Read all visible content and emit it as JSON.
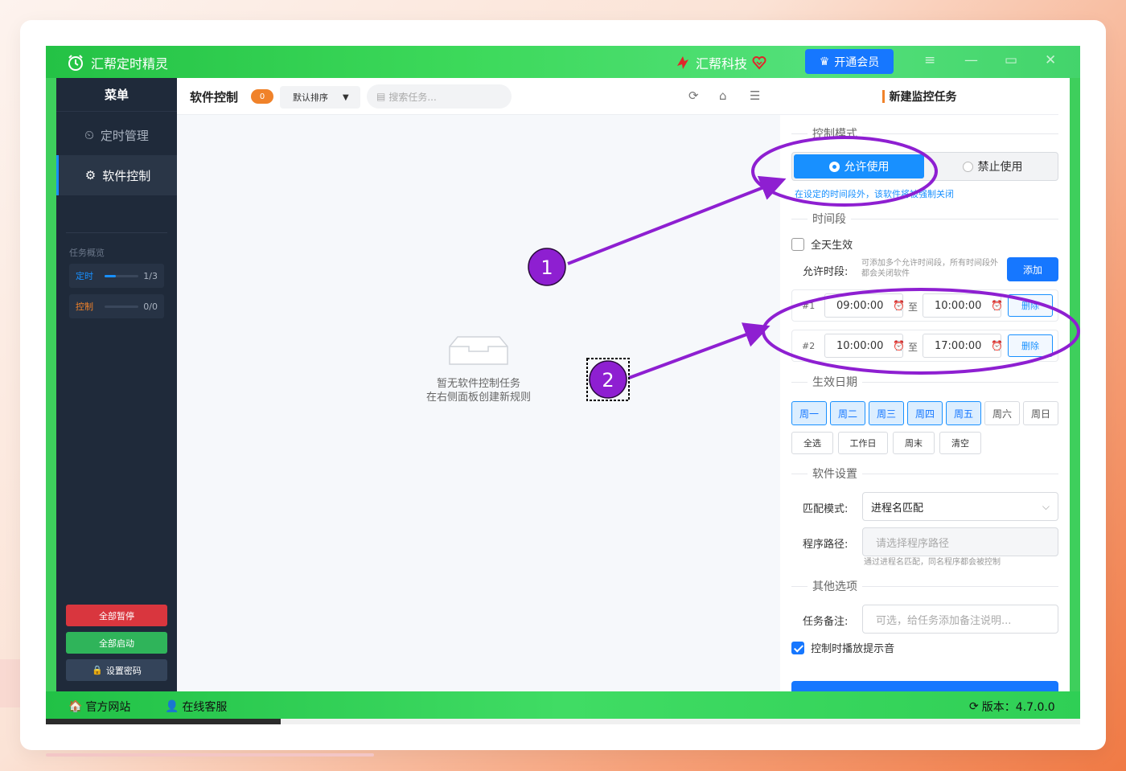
{
  "titlebar": {
    "app_title": "汇帮定时精灵",
    "brand": "汇帮科技",
    "vip_label": "开通会员"
  },
  "sidebar": {
    "header": "菜单",
    "items": [
      {
        "label": "定时管理"
      },
      {
        "label": "软件控制"
      }
    ],
    "overview_title": "任务概览",
    "overview": [
      {
        "label": "定时",
        "value": "1/3",
        "fraction": 0.33,
        "color": "#1890ff"
      },
      {
        "label": "控制",
        "value": "0/0",
        "fraction": 0,
        "color": "#f0822a"
      }
    ],
    "btn_pause_all": "全部暂停",
    "btn_start_all": "全部启动",
    "btn_set_password": "设置密码"
  },
  "content": {
    "title": "软件控制",
    "count": "0",
    "sort_label": "默认排序",
    "search_placeholder": "搜索任务...",
    "empty_line1": "暂无软件控制任务",
    "empty_line2": "在右侧面板创建新规则"
  },
  "panel": {
    "title": "新建监控任务",
    "section_mode": "控制模式",
    "mode_allow": "允许使用",
    "mode_forbid": "禁止使用",
    "mode_hint": "在设定的时间段外，该软件将被强制关闭",
    "section_time": "时间段",
    "all_day_label": "全天生效",
    "allowed_label": "允许时段:",
    "allowed_hint": "可添加多个允许时间段，所有时间段外都会关闭软件",
    "add_btn": "添加",
    "to_label": "至",
    "delete_label": "删除",
    "periods": [
      {
        "num": "#1",
        "start": "09:00:00",
        "end": "10:00:00"
      },
      {
        "num": "#2",
        "start": "10:00:00",
        "end": "17:00:00"
      }
    ],
    "section_days": "生效日期",
    "days": [
      {
        "label": "周一",
        "on": true
      },
      {
        "label": "周二",
        "on": true
      },
      {
        "label": "周三",
        "on": true
      },
      {
        "label": "周四",
        "on": true
      },
      {
        "label": "周五",
        "on": true
      },
      {
        "label": "周六",
        "on": false
      },
      {
        "label": "周日",
        "on": false
      }
    ],
    "quick": [
      "全选",
      "工作日",
      "周末",
      "清空"
    ],
    "section_software": "软件设置",
    "match_label": "匹配模式:",
    "match_value": "进程名匹配",
    "path_label": "程序路径:",
    "path_placeholder": "请选择程序路径",
    "path_hint": "通过进程名匹配，同名程序都会被控制",
    "section_other": "其他选项",
    "note_label": "任务备注:",
    "note_placeholder": "可选，给任务添加备注说明...",
    "sound_label": "控制时播放提示音"
  },
  "statusbar": {
    "website": "官方网站",
    "service": "在线客服",
    "version": "版本：4.7.0.0"
  },
  "annotations": {
    "marker1": "1",
    "marker2": "2"
  },
  "colors": {
    "accent": "#1677ff",
    "green": "#3ecf5c",
    "annotation": "#8e1fd1",
    "pause": "#d9363e",
    "start": "#2fb45a"
  }
}
